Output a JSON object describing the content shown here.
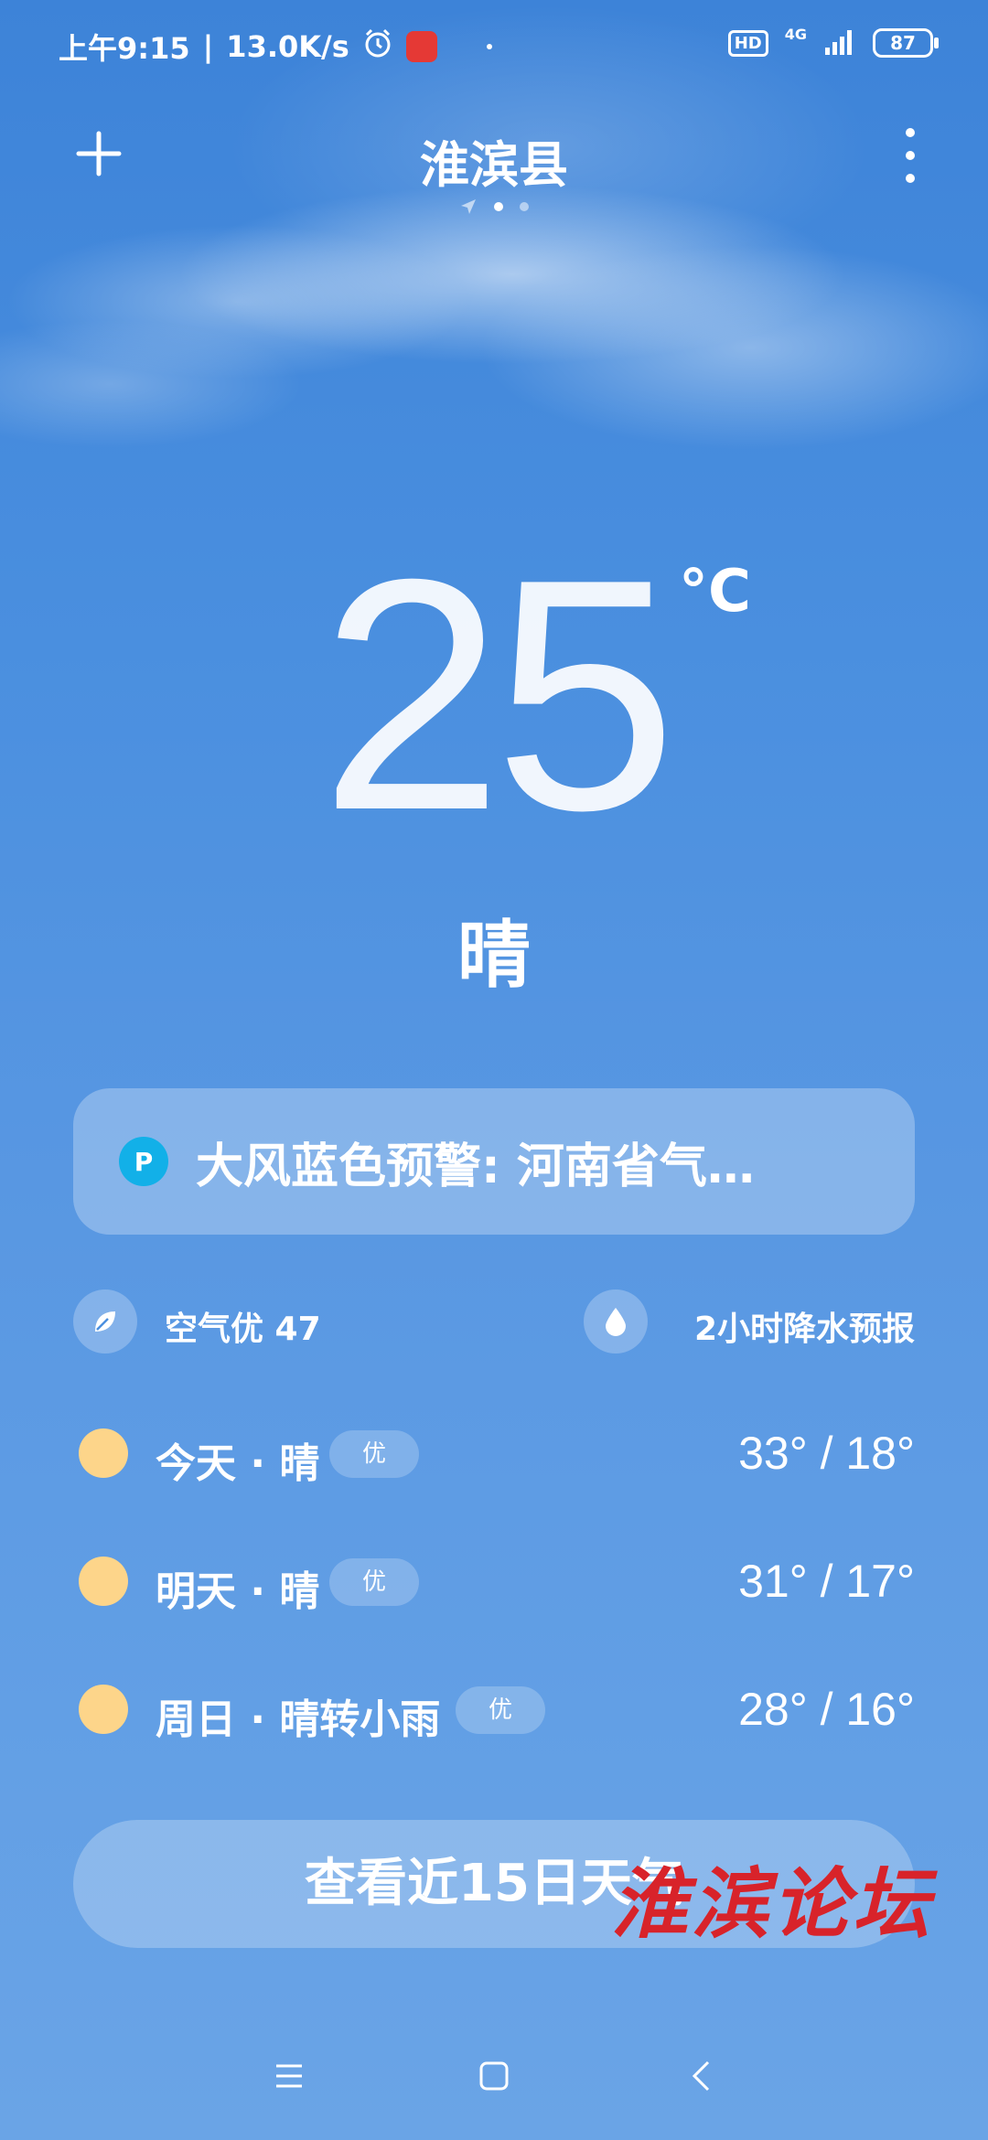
{
  "status_bar": {
    "time": "上午9:15",
    "separator": "|",
    "net_speed": "13.0K/s",
    "hd_label": "HD",
    "network_type": "4G",
    "battery": "87"
  },
  "header": {
    "city": "淮滨县",
    "page_count": 3,
    "active_page": 2
  },
  "current": {
    "temperature": "25",
    "unit": "°C",
    "condition": "晴"
  },
  "alert": {
    "icon_char": "P",
    "text": "大风蓝色预警: 河南省气…"
  },
  "info": {
    "aqi_label": "空气优 47",
    "rain_forecast_label": "2小时降水预报"
  },
  "forecast": [
    {
      "label": "今天 · 晴",
      "quality": "优",
      "temps": "33° / 18°"
    },
    {
      "label": "明天 · 晴",
      "quality": "优",
      "temps": "31° / 17°"
    },
    {
      "label": "周日 · 晴转小雨",
      "quality": "优",
      "temps": "28° / 16°"
    }
  ],
  "cta_label": "查看近15日天气",
  "watermark": "淮滨论坛",
  "colors": {
    "sky_top": "#3d83d8",
    "sky_bottom": "#6aa4e6",
    "sun": "#fdd58a",
    "alert_icon": "#12b0e8",
    "watermark": "#d8232a"
  }
}
